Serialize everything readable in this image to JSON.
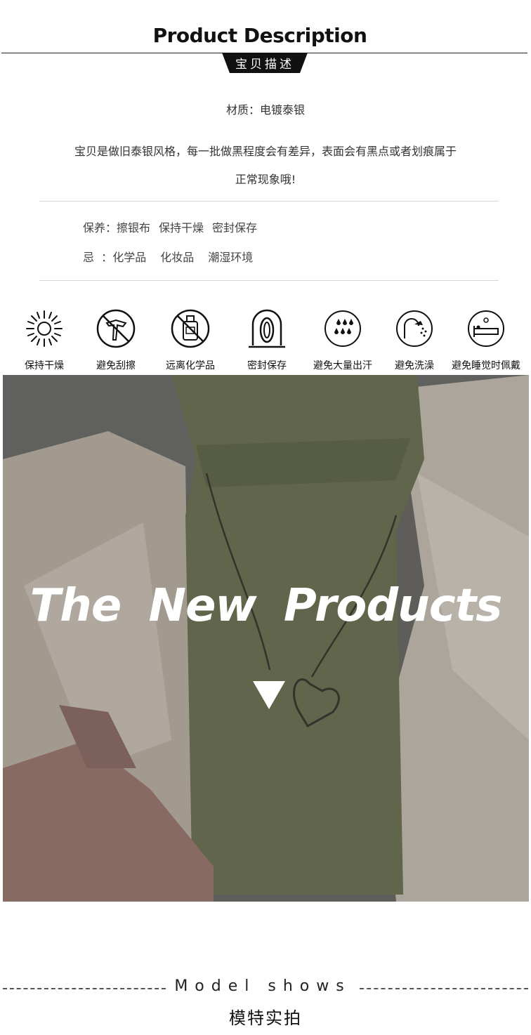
{
  "header": {
    "title": "Product Description",
    "ribbon": "宝贝描述"
  },
  "material": "材质：电镀泰银",
  "description": {
    "line1": "宝贝是做旧泰银风格，每一批做黑程度会有差异，表面会有黑点或者划痕属于",
    "line2": "正常现象哦!"
  },
  "care": {
    "label": "保养：",
    "items": [
      "擦银布",
      "保持干燥",
      "密封保存"
    ],
    "avoid_label": "忌  ：",
    "avoid_items": [
      "化学品",
      "化妆品",
      "潮湿环境"
    ]
  },
  "icons": [
    {
      "name": "sun-icon",
      "label": "保持干燥"
    },
    {
      "name": "no-scratch-icon",
      "label": "避免刮擦"
    },
    {
      "name": "no-chemicals-icon",
      "label": "远离化学品"
    },
    {
      "name": "sealed-icon",
      "label": "密封保存"
    },
    {
      "name": "no-sweat-icon",
      "label": "避免大量出汗"
    },
    {
      "name": "no-shower-icon",
      "label": "避免洗澡"
    },
    {
      "name": "no-sleep-icon",
      "label": "避免睡觉时佩戴"
    }
  ],
  "photo": {
    "overlay_text": "The New Products",
    "colors": {
      "sweater": "#6f7457",
      "coat": "#bdb3a5",
      "shade": "#4a4a48"
    }
  },
  "footer": {
    "model_shows": "Model shows",
    "model_cn": "模特实拍"
  }
}
